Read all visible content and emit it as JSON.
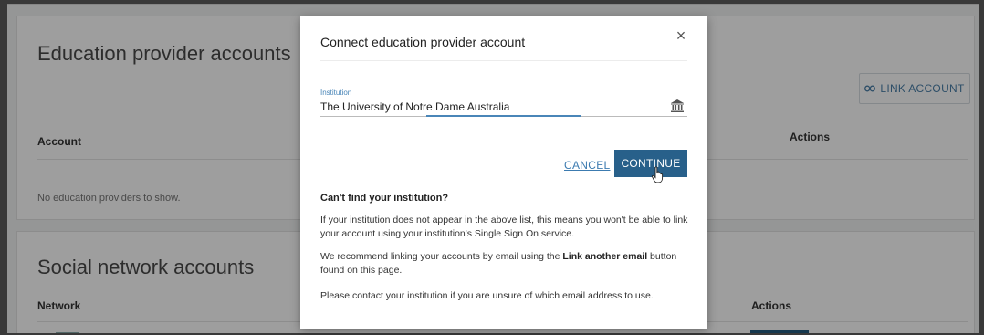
{
  "background": {
    "education": {
      "title": "Education provider accounts",
      "link_button_label": "LINK ACCOUNT",
      "columns": {
        "account": "Account",
        "actions": "Actions"
      },
      "empty_message": "No education providers to show."
    },
    "social": {
      "title": "Social network accounts",
      "columns": {
        "network": "Network",
        "actions": "Actions"
      }
    }
  },
  "modal": {
    "title": "Connect education provider account",
    "close_glyph": "×",
    "institution_field": {
      "label": "Institution",
      "value": "The University of Notre Dame Australia"
    },
    "cancel_label": "CANCEL",
    "continue_label": "CONTINUE",
    "help": {
      "heading": "Can't find your institution?",
      "p1": "If your institution does not appear in the above list, this means you won't be able to link your account using your institution's Single Sign On service.",
      "p2_before": "We recommend linking your accounts by email using the ",
      "p2_bold": "Link another email",
      "p2_after": " button found on this page.",
      "p3": "Please contact your institution if you are unsure of which email address to use."
    }
  },
  "colors": {
    "accent": "#28608a",
    "link": "#3c7bb0",
    "label": "#4a86b8"
  },
  "icons": [
    "link-icon",
    "bank-icon",
    "close-icon",
    "hand-cursor-icon"
  ]
}
